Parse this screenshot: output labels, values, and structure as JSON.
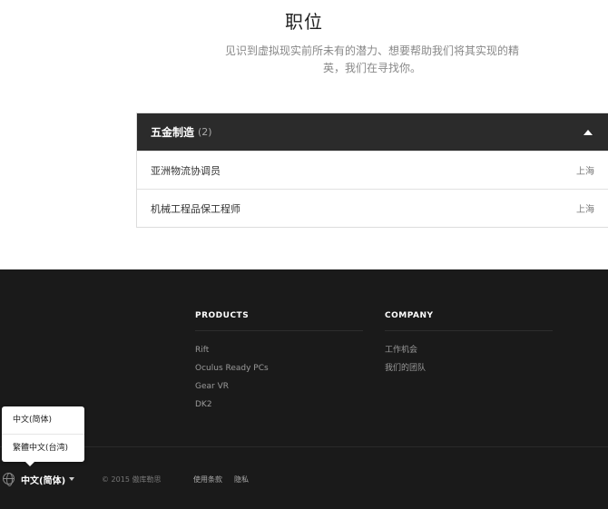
{
  "hero": {
    "title": "职位",
    "subtitle": "见识到虚拟现实前所未有的潜力、想要帮助我们将其实现的精英，我们在寻找你。"
  },
  "department": {
    "name": "五金制造",
    "count": "(2)",
    "jobs": [
      {
        "title": "亚洲物流协调员",
        "location": "上海"
      },
      {
        "title": "机械工程品保工程师",
        "location": "上海"
      }
    ]
  },
  "footer": {
    "products": {
      "title": "PRODUCTS",
      "links": [
        "Rift",
        "Oculus Ready PCs",
        "Gear VR",
        "DK2"
      ]
    },
    "company": {
      "title": "COMPANY",
      "links": [
        "工作机会",
        "我们的团队"
      ]
    },
    "language": {
      "current": "中文(简体)",
      "options": [
        "中文(简体)",
        "繁體中文(台湾)"
      ]
    },
    "copyright": "© 2015 傲库勒思",
    "terms": "使用条款",
    "privacy": "隐私"
  },
  "colors": {
    "footer_bg": "#1a1a1a",
    "header_bar": "#2b2b2b"
  }
}
